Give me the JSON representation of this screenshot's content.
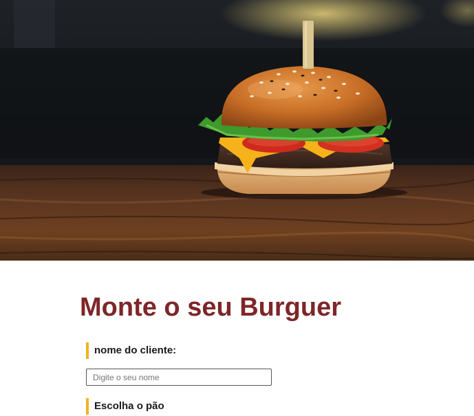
{
  "hero": {
    "image": "burger-photo"
  },
  "page": {
    "title": "Monte o seu Burguer"
  },
  "form": {
    "client_name_label": "nome do cliente:",
    "client_name_placeholder": "Digite o seu nome",
    "client_name_value": "",
    "bread_label": "Escolha o pão"
  },
  "colors": {
    "title": "#7e2629",
    "label_accent": "#f0b323",
    "input_border": "#555555"
  }
}
